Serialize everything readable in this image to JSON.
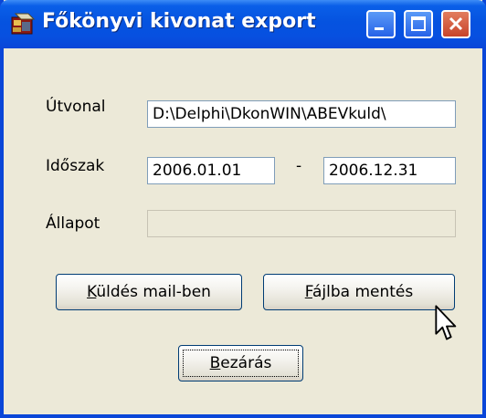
{
  "window": {
    "title": "Főkönyvi kivonat export",
    "icons": {
      "app": "app-logo-icon",
      "minimize": "minimize-icon",
      "maximize": "maximize-icon",
      "close": "close-icon"
    }
  },
  "form": {
    "path_label": "Útvonal",
    "path_value": "D:\\Delphi\\DkonWIN\\ABEVkuld\\",
    "period_label": "Időszak",
    "period_from": "2006.01.01",
    "period_separator": "-",
    "period_to": "2006.12.31",
    "status_label": "Állapot",
    "status_value": ""
  },
  "buttons": {
    "send_mail": {
      "accel": "K",
      "rest": "üldés mail-ben"
    },
    "save_file": {
      "accel": "F",
      "rest": "ájlba mentés"
    },
    "close": {
      "accel": "B",
      "rest": "ezárás"
    }
  },
  "cursor": {
    "icon": "arrow-cursor-icon"
  }
}
